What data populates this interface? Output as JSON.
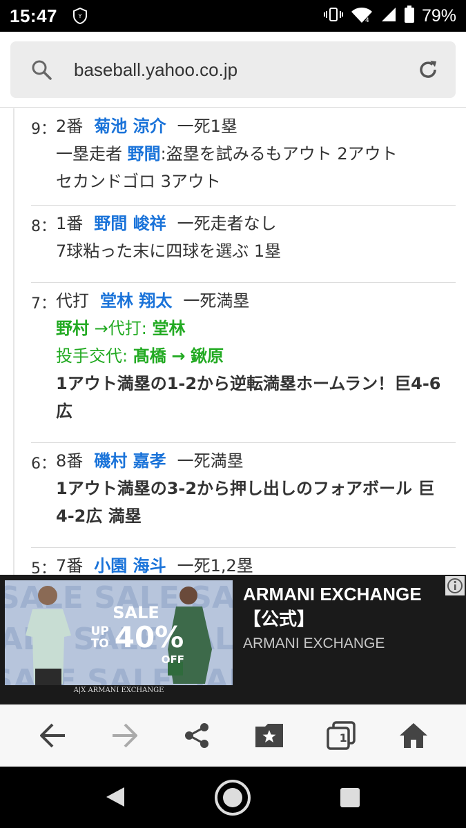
{
  "status_bar": {
    "time": "15:47",
    "battery_percent": "79%",
    "icons": [
      "shield-icon",
      "vibrate-icon",
      "wifi-icon",
      "signal-icon",
      "battery-icon"
    ]
  },
  "url_bar": {
    "url": "baseball.yahoo.co.jp"
  },
  "plays": [
    {
      "number": "9：",
      "order": "2番",
      "player": "菊池 涼介",
      "situation": "一死1塁",
      "detail_prefix": "一塁走者",
      "detail_runner": "野間",
      "detail_suffix": ":盗塁を試みるもアウト 2アウト",
      "detail2": "セカンドゴロ 3アウト"
    },
    {
      "number": "8：",
      "order": "1番",
      "player": "野間 峻祥",
      "situation": "一死走者なし",
      "detail": "7球粘った末に四球を選ぶ 1塁"
    },
    {
      "number": "7：",
      "order": "代打",
      "player": "堂林 翔太",
      "situation": "一死満塁",
      "sub1_out": "野村",
      "sub1_mid": "→代打:",
      "sub1_in": "堂林",
      "sub2_label": "投手交代:",
      "sub2_out": "髙橋",
      "sub2_arrow": "→",
      "sub2_in": "鍬原",
      "result": "1アウト満塁の1-2から逆転満塁ホームラン！巨4-6広"
    },
    {
      "number": "6：",
      "order": "8番",
      "player": "磯村 嘉孝",
      "situation": "一死満塁",
      "result": "1アウト満塁の3-2から押し出しのフォアボール 巨4-2広 満塁"
    },
    {
      "number": "5：",
      "order": "7番",
      "player": "小園 海斗",
      "situation": "一死1,2塁"
    }
  ],
  "ad": {
    "title": "ARMANI EXCHANGE【公式】",
    "advertiser": "ARMANI EXCHANGE",
    "image_sale": "SALE",
    "image_upto": "UP TO",
    "image_percent": "40%",
    "image_off": "OFF",
    "image_brand": "A|X ARMANI EXCHANGE"
  },
  "toolbar": {
    "tab_count": "1",
    "icons": [
      "back-arrow-icon",
      "forward-arrow-icon",
      "share-icon",
      "bookmark-icon",
      "tabs-icon",
      "home-icon"
    ]
  },
  "colors": {
    "link_blue": "#1a73d9",
    "sub_green": "#22aa22",
    "ad_bg": "#1a1a1a"
  }
}
